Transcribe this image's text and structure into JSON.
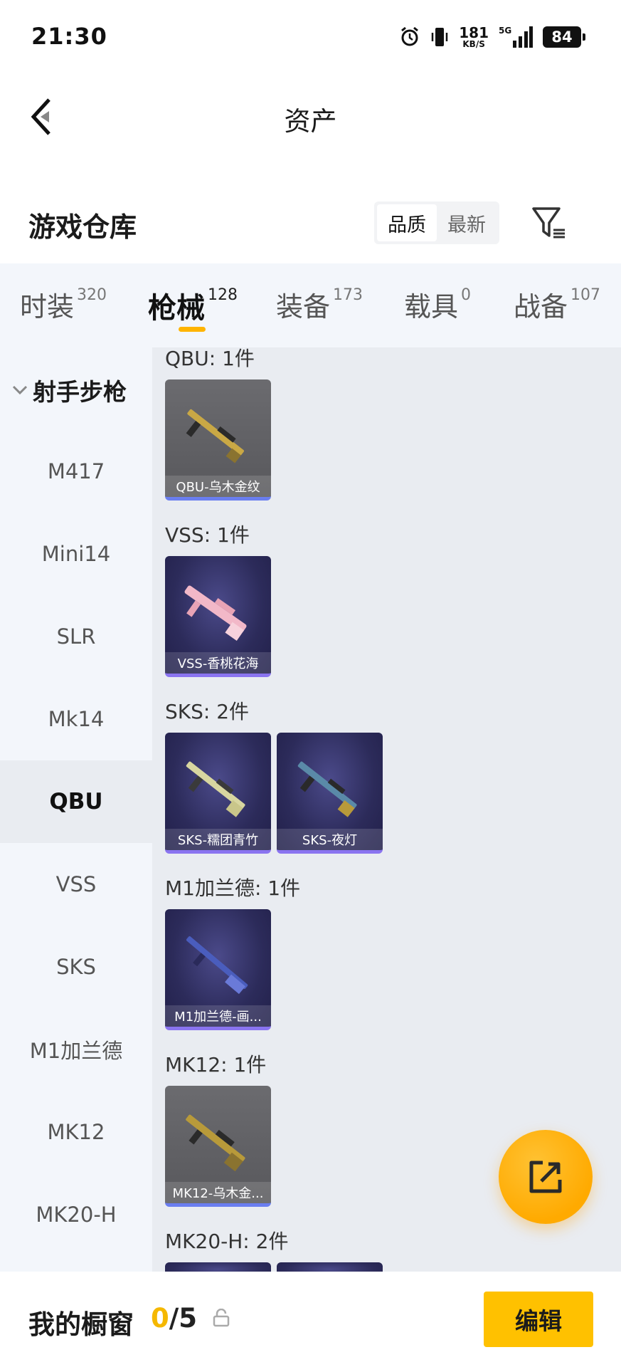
{
  "status_bar": {
    "time": "21:30",
    "speed_value": "181",
    "speed_unit": "KB/S",
    "network": "5G",
    "battery": "84"
  },
  "header": {
    "title": "资产"
  },
  "section": {
    "title": "游戏仓库",
    "sort_options": [
      "品质",
      "最新"
    ],
    "sort_selected": "品质"
  },
  "tabs": [
    {
      "label": "时装",
      "count": "320"
    },
    {
      "label": "枪械",
      "count": "128"
    },
    {
      "label": "装备",
      "count": "173"
    },
    {
      "label": "载具",
      "count": "0"
    },
    {
      "label": "战备",
      "count": "107"
    }
  ],
  "active_tab": "枪械",
  "sidebar": {
    "group": "射手步枪",
    "items": [
      "M417",
      "Mini14",
      "SLR",
      "Mk14",
      "QBU",
      "VSS",
      "SKS",
      "M1加兰德",
      "MK12",
      "MK20-H"
    ],
    "selected": "QBU"
  },
  "content": {
    "groups": [
      {
        "title": "QBU: 1件",
        "items": [
          {
            "name": "QBU-乌木金纹",
            "style": "gray",
            "weapon_color": "#c9a845"
          }
        ]
      },
      {
        "title": "VSS: 1件",
        "items": [
          {
            "name": "VSS-香桃花海",
            "style": "purple",
            "weapon_color": "#f2b8c8"
          }
        ]
      },
      {
        "title": "SKS: 2件",
        "items": [
          {
            "name": "SKS-糯团青竹",
            "style": "purple",
            "weapon_color": "#d8d6a0"
          },
          {
            "name": "SKS-夜灯",
            "style": "purple",
            "weapon_color": "#5a8aa8"
          }
        ]
      },
      {
        "title": "M1加兰德: 1件",
        "items": [
          {
            "name": "M1加兰德-画...",
            "style": "purple",
            "weapon_color": "#4a5dbd"
          }
        ]
      },
      {
        "title": "MK12: 1件",
        "items": [
          {
            "name": "MK12-乌木金...",
            "style": "gray",
            "weapon_color": "#b89a3a"
          }
        ]
      },
      {
        "title": "MK20-H: 2件",
        "items": []
      }
    ]
  },
  "bottom_bar": {
    "label": "我的橱窗",
    "current": "0",
    "separator": "/",
    "total": "5",
    "edit_label": "编辑"
  },
  "colors": {
    "accent": "#ffc100",
    "tab_indicator": "#ffb400",
    "highlight_text": "#f5b800"
  },
  "icons": [
    "back-arrow-icon",
    "filter-icon",
    "share-icon",
    "lock-icon",
    "chevron-down-icon",
    "alarm-icon",
    "vibrate-icon",
    "signal-icon"
  ]
}
